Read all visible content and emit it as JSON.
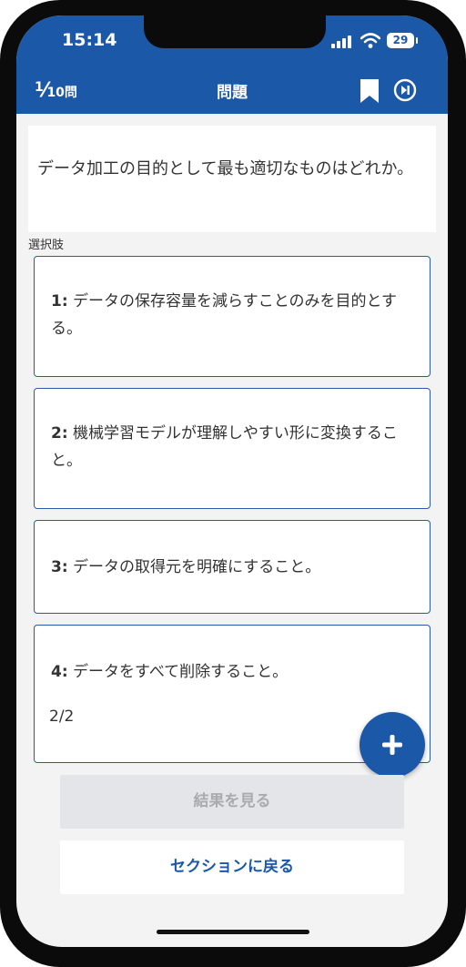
{
  "status_bar": {
    "time": "15:14",
    "battery": "29"
  },
  "header": {
    "counter_current": "1",
    "counter_slash": "⁄",
    "counter_total": "10問",
    "title": "問題"
  },
  "question": {
    "text": "データ加工の目的として最も適切なものはどれか。"
  },
  "choices_label": "選択肢",
  "choices": [
    {
      "num": "1:",
      "text": "データの保存容量を減らすことのみを目的とする。"
    },
    {
      "num": "2:",
      "text": "機械学習モデルが理解しやすい形に変換すること。"
    },
    {
      "num": "3:",
      "text": "データの取得元を明確にすること。"
    },
    {
      "num": "4:",
      "text": "データをすべて削除すること。"
    }
  ],
  "page_indicator": "2/2",
  "buttons": {
    "see_results": "結果を見る",
    "back_to_section": "セクションに戻る"
  },
  "colors": {
    "header": "#1c58a8",
    "choice_border": "#2a5aa6",
    "disabled_button": "#e3e5e8",
    "background": "#f3f3f3"
  },
  "icons": [
    "signal-icon",
    "wifi-icon",
    "bookmark-icon",
    "skip-icon",
    "plus-icon"
  ]
}
